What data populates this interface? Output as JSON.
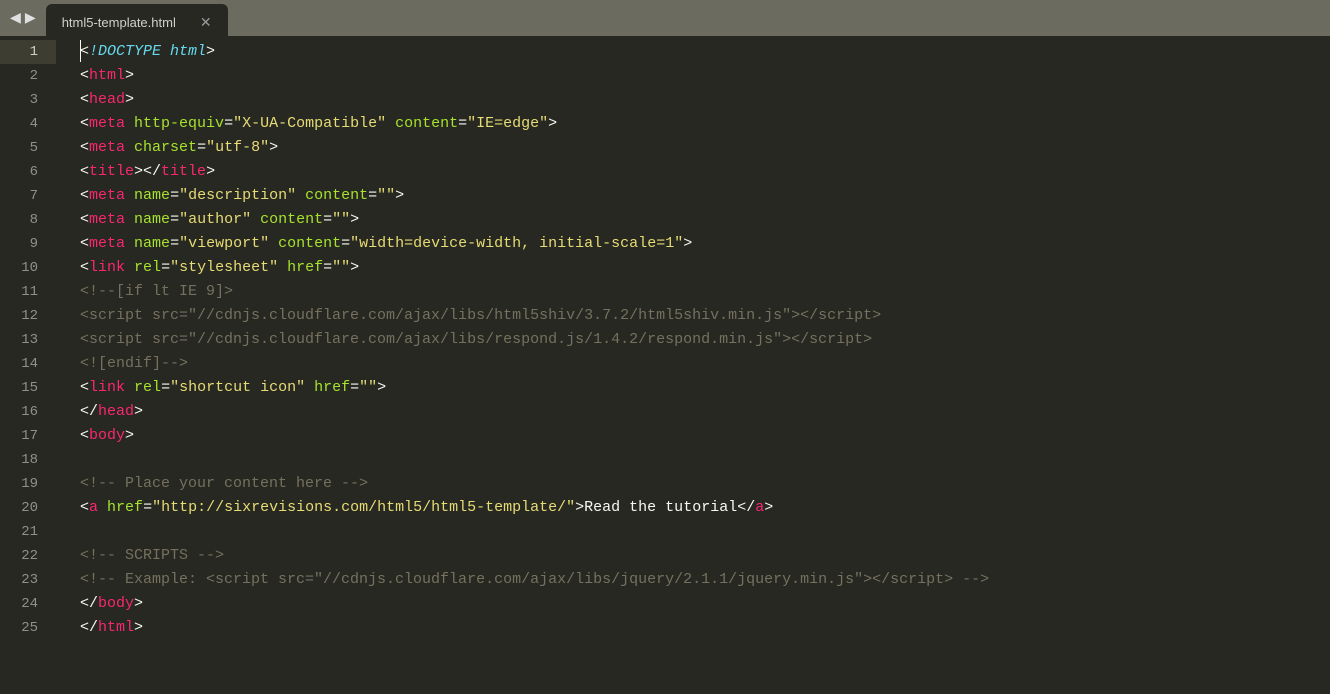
{
  "tab": {
    "title": "html5-template.html"
  },
  "line_numbers": [
    "1",
    "2",
    "3",
    "4",
    "5",
    "6",
    "7",
    "8",
    "9",
    "10",
    "11",
    "12",
    "13",
    "14",
    "15",
    "16",
    "17",
    "18",
    "19",
    "20",
    "21",
    "22",
    "23",
    "24",
    "25"
  ],
  "code": {
    "1": {
      "ob": "<",
      "doctype": "!DOCTYPE html",
      "cb": ">"
    },
    "2": {
      "ob": "<",
      "tag": "html",
      "cb": ">"
    },
    "3": {
      "ob": "<",
      "tag": "head",
      "cb": ">"
    },
    "4": {
      "ob": "<",
      "tag": "meta",
      "sp1": " ",
      "a1": "http-equiv",
      "e1": "=",
      "v1": "\"X-UA-Compatible\"",
      "sp2": " ",
      "a2": "content",
      "e2": "=",
      "v2": "\"IE=edge\"",
      "cb": ">"
    },
    "5": {
      "ob": "<",
      "tag": "meta",
      "sp1": " ",
      "a1": "charset",
      "e1": "=",
      "v1": "\"utf-8\"",
      "cb": ">"
    },
    "6": {
      "ob": "<",
      "tag": "title",
      "mid": "></",
      "tag2": "title",
      "cb": ">"
    },
    "7": {
      "ob": "<",
      "tag": "meta",
      "sp1": " ",
      "a1": "name",
      "e1": "=",
      "v1": "\"description\"",
      "sp2": " ",
      "a2": "content",
      "e2": "=",
      "v2": "\"\"",
      "cb": ">"
    },
    "8": {
      "ob": "<",
      "tag": "meta",
      "sp1": " ",
      "a1": "name",
      "e1": "=",
      "v1": "\"author\"",
      "sp2": " ",
      "a2": "content",
      "e2": "=",
      "v2": "\"\"",
      "cb": ">"
    },
    "9": {
      "ob": "<",
      "tag": "meta",
      "sp1": " ",
      "a1": "name",
      "e1": "=",
      "v1": "\"viewport\"",
      "sp2": " ",
      "a2": "content",
      "e2": "=",
      "v2": "\"width=device-width, initial-scale=1\"",
      "cb": ">"
    },
    "10": {
      "ob": "<",
      "tag": "link",
      "sp1": " ",
      "a1": "rel",
      "e1": "=",
      "v1": "\"stylesheet\"",
      "sp2": " ",
      "a2": "href",
      "e2": "=",
      "v2": "\"\"",
      "cb": ">"
    },
    "11": {
      "text": "<!--[if lt IE 9]>"
    },
    "12": {
      "text": "<script src=\"//cdnjs.cloudflare.com/ajax/libs/html5shiv/3.7.2/html5shiv.min.js\"></script>"
    },
    "13": {
      "text": "<script src=\"//cdnjs.cloudflare.com/ajax/libs/respond.js/1.4.2/respond.min.js\"></script>"
    },
    "14": {
      "text": "<![endif]-->"
    },
    "15": {
      "ob": "<",
      "tag": "link",
      "sp1": " ",
      "a1": "rel",
      "e1": "=",
      "v1": "\"shortcut icon\"",
      "sp2": " ",
      "a2": "href",
      "e2": "=",
      "v2": "\"\"",
      "cb": ">"
    },
    "16": {
      "ob": "</",
      "tag": "head",
      "cb": ">"
    },
    "17": {
      "ob": "<",
      "tag": "body",
      "cb": ">"
    },
    "18": {
      "text": ""
    },
    "19": {
      "text": "<!-- Place your content here -->"
    },
    "20": {
      "ob": "<",
      "tag": "a",
      "sp1": " ",
      "a1": "href",
      "e1": "=",
      "v1": "\"http://sixrevisions.com/html5/html5-template/\"",
      "cb": ">",
      "txt": "Read the tutorial",
      "ob2": "</",
      "tag2": "a",
      "cb2": ">"
    },
    "21": {
      "text": ""
    },
    "22": {
      "text": "<!-- SCRIPTS -->"
    },
    "23": {
      "text": "<!-- Example: <script src=\"//cdnjs.cloudflare.com/ajax/libs/jquery/2.1.1/jquery.min.js\"></script> -->"
    },
    "24": {
      "ob": "</",
      "tag": "body",
      "cb": ">"
    },
    "25": {
      "ob": "</",
      "tag": "html",
      "cb": ">"
    }
  }
}
